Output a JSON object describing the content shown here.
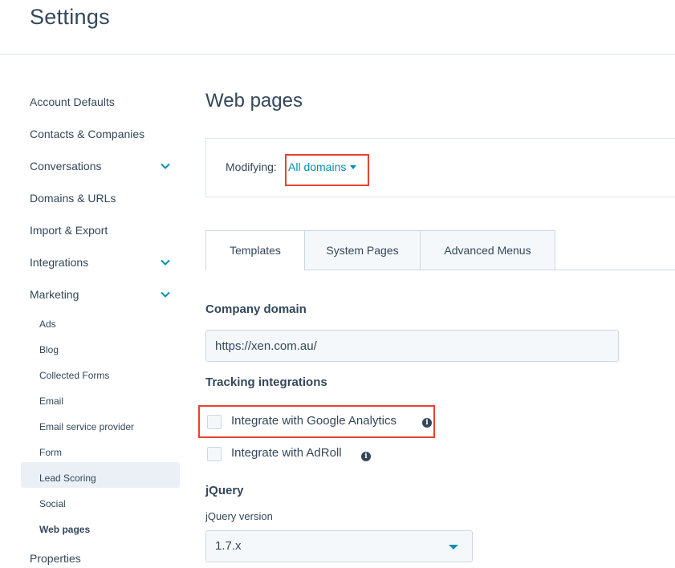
{
  "header": {
    "title": "Settings"
  },
  "sidebar": {
    "items": [
      {
        "label": "Account Defaults"
      },
      {
        "label": "Contacts & Companies"
      },
      {
        "label": "Conversations"
      },
      {
        "label": "Domains & URLs"
      },
      {
        "label": "Import & Export"
      },
      {
        "label": "Integrations"
      },
      {
        "label": "Marketing"
      }
    ],
    "marketing_subitems": [
      {
        "label": "Ads"
      },
      {
        "label": "Blog"
      },
      {
        "label": "Collected Forms"
      },
      {
        "label": "Email"
      },
      {
        "label": "Email service provider"
      },
      {
        "label": "Form"
      },
      {
        "label": "Lead Scoring"
      },
      {
        "label": "Social"
      },
      {
        "label": "Web pages"
      }
    ],
    "next_item_partial": "Properties"
  },
  "main": {
    "title": "Web pages",
    "modifying_label": "Modifying:",
    "modifying_value": "All domains",
    "tabs": [
      {
        "label": "Templates"
      },
      {
        "label": "System Pages"
      },
      {
        "label": "Advanced Menus"
      }
    ],
    "company_domain": {
      "heading": "Company domain",
      "value": "https://xen.com.au/"
    },
    "tracking": {
      "heading": "Tracking integrations",
      "google_analytics_label": "Integrate with Google Analytics",
      "adroll_label": "Integrate with AdRoll"
    },
    "jquery": {
      "heading": "jQuery",
      "version_label": "jQuery version",
      "version_value": "1.7.x"
    }
  },
  "icons": {
    "info": "info-icon",
    "chevron": "chevron-down-icon",
    "caret": "caret-down-icon"
  },
  "colors": {
    "text": "#33475b",
    "link": "#0091ae",
    "highlight_box": "#e8432c",
    "border": "#cbd6e2",
    "input_bg": "#f5f8fa",
    "active_bg": "#eaf0f6"
  }
}
